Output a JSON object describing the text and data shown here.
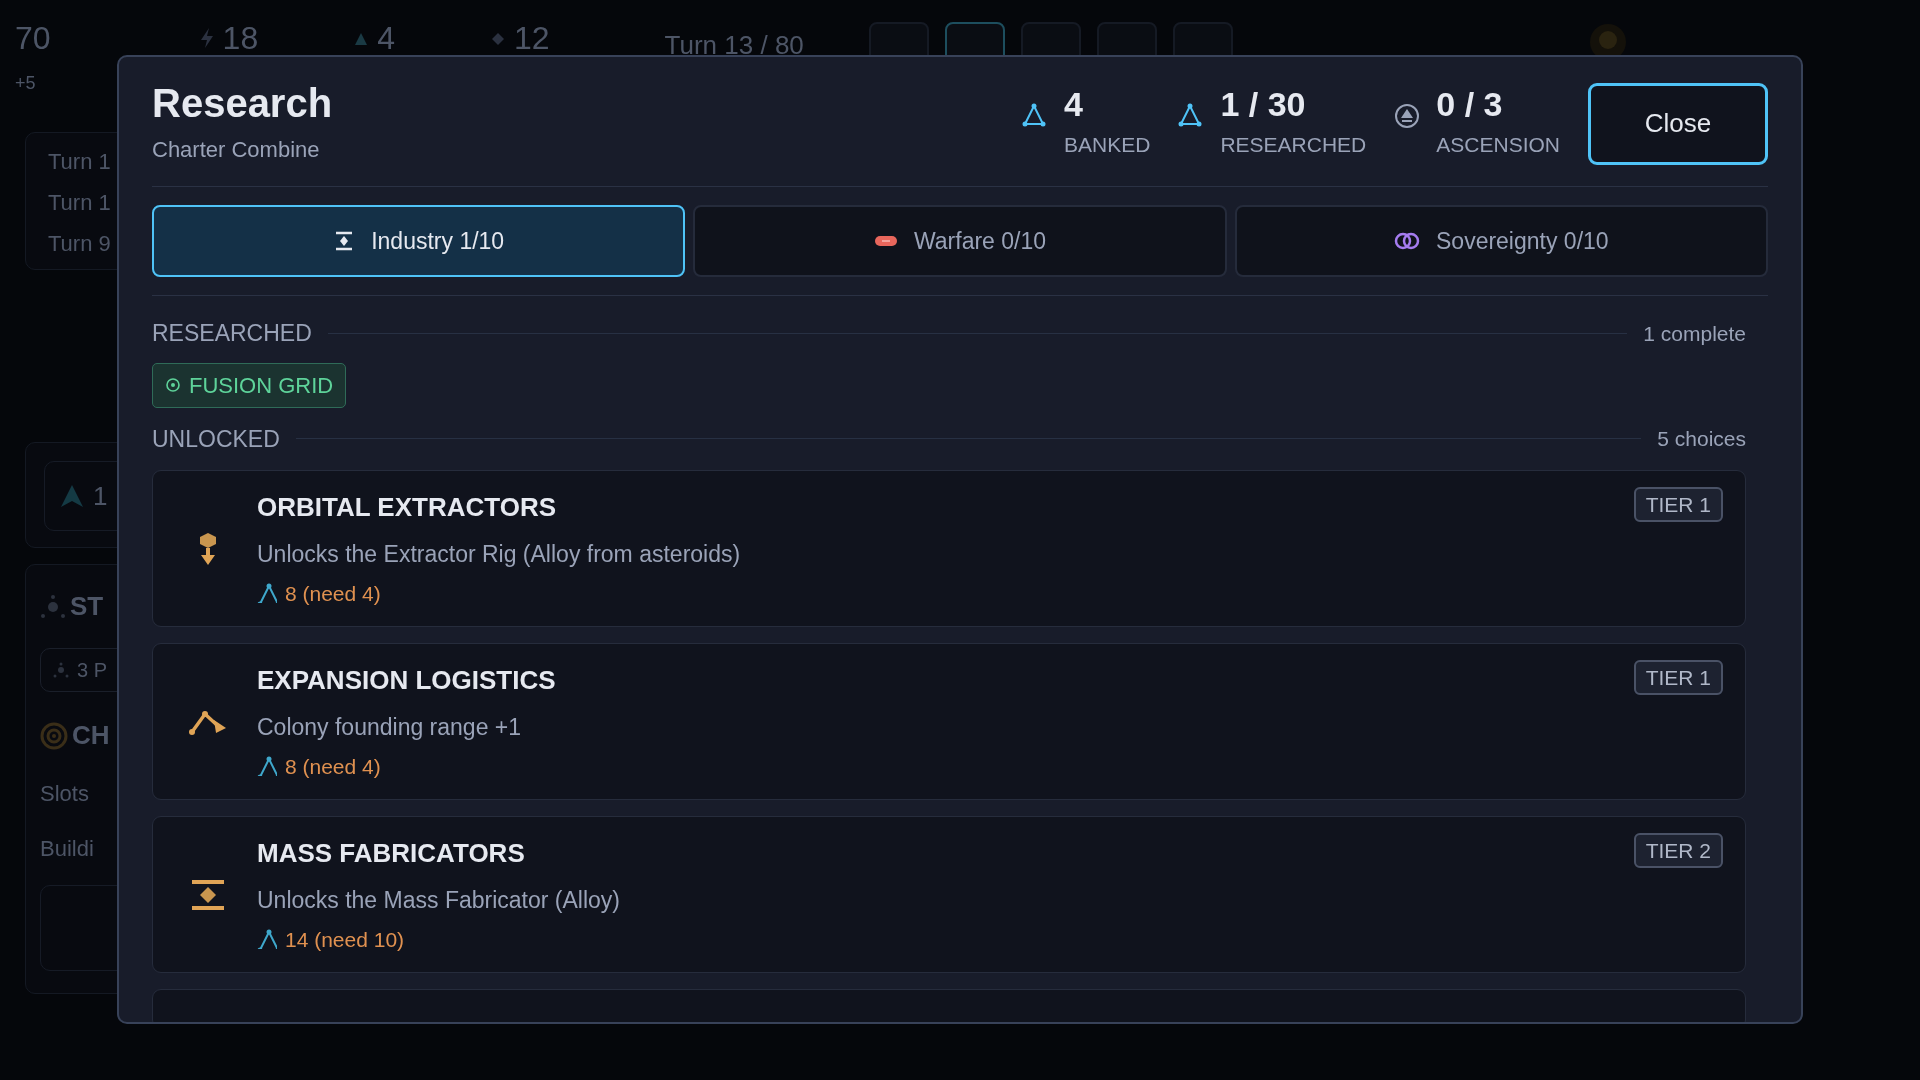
{
  "background": {
    "top_bar": {
      "credits": "70",
      "credits_delta": "+5",
      "stats": [
        {
          "value": "18",
          "kind": "energy"
        },
        {
          "value": "4",
          "kind": "research"
        },
        {
          "value": "12",
          "kind": "alloy"
        }
      ],
      "turn": "Turn 13 / 80",
      "toolbar": [
        {
          "selected": false
        },
        {
          "selected": true
        },
        {
          "selected": false
        },
        {
          "selected": false
        },
        {
          "selected": false
        }
      ]
    },
    "history": [
      "Turn 1",
      "Turn 1",
      "Turn 9"
    ],
    "summary": "1",
    "station": {
      "title": "ST",
      "chip": "3 P",
      "section": "CH",
      "rows": [
        "Slots",
        "Buildi"
      ]
    }
  },
  "modal": {
    "title": "Research",
    "subtitle": "Charter Combine",
    "stats": [
      {
        "value": "4",
        "label": "BANKED",
        "kind": "research"
      },
      {
        "value": "1 / 30",
        "label": "RESEARCHED",
        "kind": "research"
      },
      {
        "value": "0 / 3",
        "label": "ASCENSION",
        "kind": "ascension"
      }
    ],
    "close": "Close",
    "tabs": [
      {
        "label": "Industry 1/10",
        "kind": "industry",
        "selected": true
      },
      {
        "label": "Warfare 0/10",
        "kind": "warfare",
        "selected": false
      },
      {
        "label": "Sovereignty 0/10",
        "kind": "sovereignty",
        "selected": false
      }
    ],
    "researched": {
      "title": "RESEARCHED",
      "count": "1 complete",
      "items": [
        {
          "label": "FUSION GRID"
        }
      ]
    },
    "unlocked": {
      "title": "UNLOCKED",
      "count": "5 choices",
      "items": [
        {
          "name": "ORBITAL EXTRACTORS",
          "description": "Unlocks the Extractor Rig (Alloy from asteroids)",
          "cost": "8 (need 4)",
          "tier": "TIER 1",
          "kind": "extractor"
        },
        {
          "name": "EXPANSION LOGISTICS",
          "description": "Colony founding range +1",
          "cost": "8 (need 4)",
          "tier": "TIER 1",
          "kind": "route"
        },
        {
          "name": "MASS FABRICATORS",
          "description": "Unlocks the Mass Fabricator (Alloy)",
          "cost": "14 (need 10)",
          "tier": "TIER 2",
          "kind": "fabricator"
        }
      ]
    }
  }
}
